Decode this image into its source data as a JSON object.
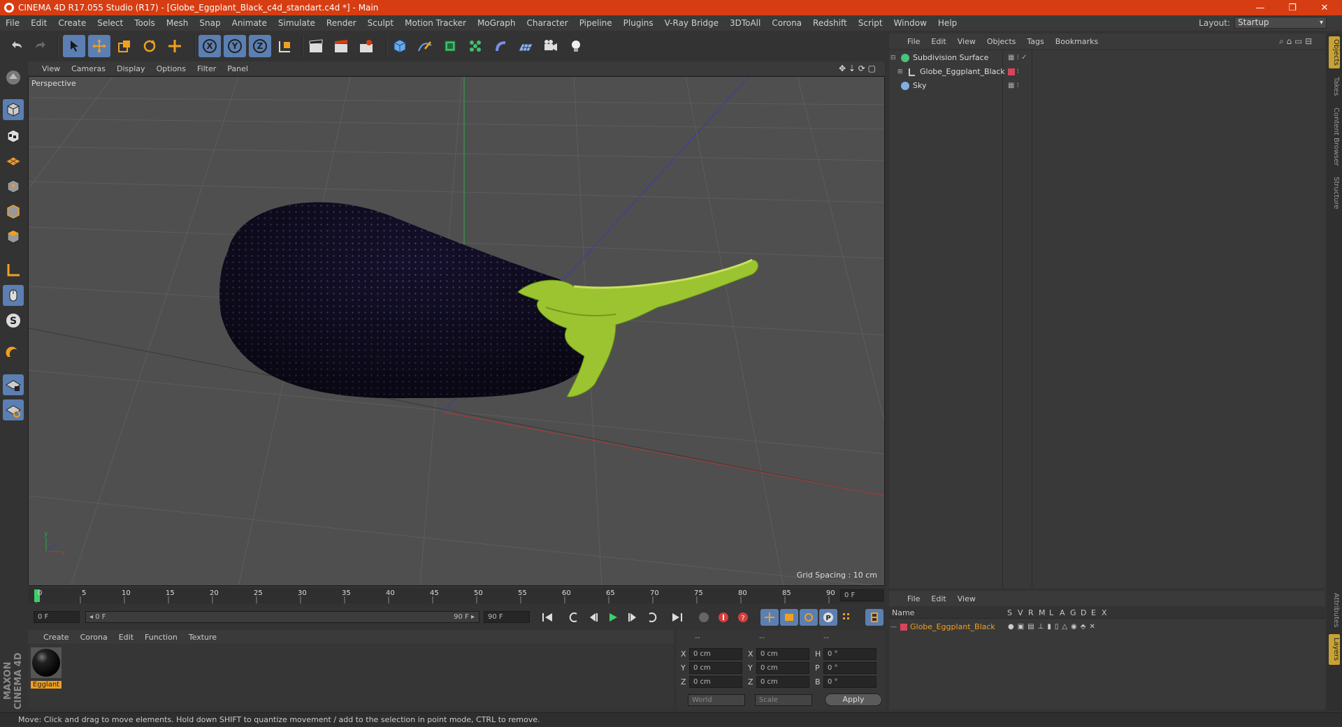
{
  "window": {
    "title": "CINEMA 4D R17.055 Studio (R17) - [Globe_Eggplant_Black_c4d_standart.c4d *] - Main",
    "minimize": "—",
    "restore": "❐",
    "close": "✕"
  },
  "menu": [
    "File",
    "Edit",
    "Create",
    "Select",
    "Tools",
    "Mesh",
    "Snap",
    "Animate",
    "Simulate",
    "Render",
    "Sculpt",
    "Motion Tracker",
    "MoGraph",
    "Character",
    "Pipeline",
    "Plugins",
    "V-Ray Bridge",
    "3DToAll",
    "Corona",
    "Redshift",
    "Script",
    "Window",
    "Help"
  ],
  "layout": {
    "label": "Layout:",
    "value": "Startup"
  },
  "viewport": {
    "menu": [
      "View",
      "Cameras",
      "Display",
      "Options",
      "Filter",
      "Panel"
    ],
    "label": "Perspective",
    "grid_spacing": "Grid Spacing : 10 cm"
  },
  "timeline": {
    "ticks": [
      "0",
      "5",
      "10",
      "15",
      "20",
      "25",
      "30",
      "35",
      "40",
      "45",
      "50",
      "55",
      "60",
      "65",
      "70",
      "75",
      "80",
      "85",
      "90"
    ],
    "current_frame": "0 F",
    "start_field": "0 F",
    "range_left": "◂ 0 F",
    "range_right": "90 F ▸",
    "end_field": "90 F"
  },
  "material": {
    "menu": [
      "Create",
      "Corona",
      "Edit",
      "Function",
      "Texture"
    ],
    "items": [
      {
        "name": "Egglant"
      }
    ]
  },
  "coords": {
    "header": [
      "--",
      "--",
      "--"
    ],
    "rows": [
      {
        "a": "X",
        "av": "0 cm",
        "b": "X",
        "bv": "0 cm",
        "c": "H",
        "cv": "0 °"
      },
      {
        "a": "Y",
        "av": "0 cm",
        "b": "Y",
        "bv": "0 cm",
        "c": "P",
        "cv": "0 °"
      },
      {
        "a": "Z",
        "av": "0 cm",
        "b": "Z",
        "bv": "0 cm",
        "c": "B",
        "cv": "0 °"
      }
    ],
    "mode1": "World",
    "mode2": "Scale",
    "apply": "Apply"
  },
  "objects": {
    "menu": [
      "File",
      "Edit",
      "View",
      "Objects",
      "Tags",
      "Bookmarks"
    ],
    "items": [
      {
        "name": "Subdivision Surface",
        "color": "#4bc27a"
      },
      {
        "name": "Globe_Eggplant_Black",
        "color": "#cccccc"
      },
      {
        "name": "Sky",
        "color": "#7fb0e0"
      }
    ]
  },
  "layers": {
    "menu": [
      "File",
      "Edit",
      "View"
    ],
    "columns": [
      "Name",
      "S",
      "V",
      "R",
      "M",
      "L",
      "A",
      "G",
      "D",
      "E",
      "X"
    ],
    "items": [
      {
        "name": "Globe_Eggplant_Black",
        "color": "#d6455a"
      }
    ]
  },
  "right_tabs": [
    "Objects",
    "Takes",
    "Content Browser",
    "Structure",
    "Attributes",
    "Layers"
  ],
  "brand": "MAXON CINEMA 4D",
  "status": "Move: Click and drag to move elements. Hold down SHIFT to quantize movement / add to the selection in point mode, CTRL to remove.",
  "colors": {
    "title_bar": "#d63d12",
    "highlight": "#5b7fb2",
    "accent_orange": "#f0a020"
  }
}
